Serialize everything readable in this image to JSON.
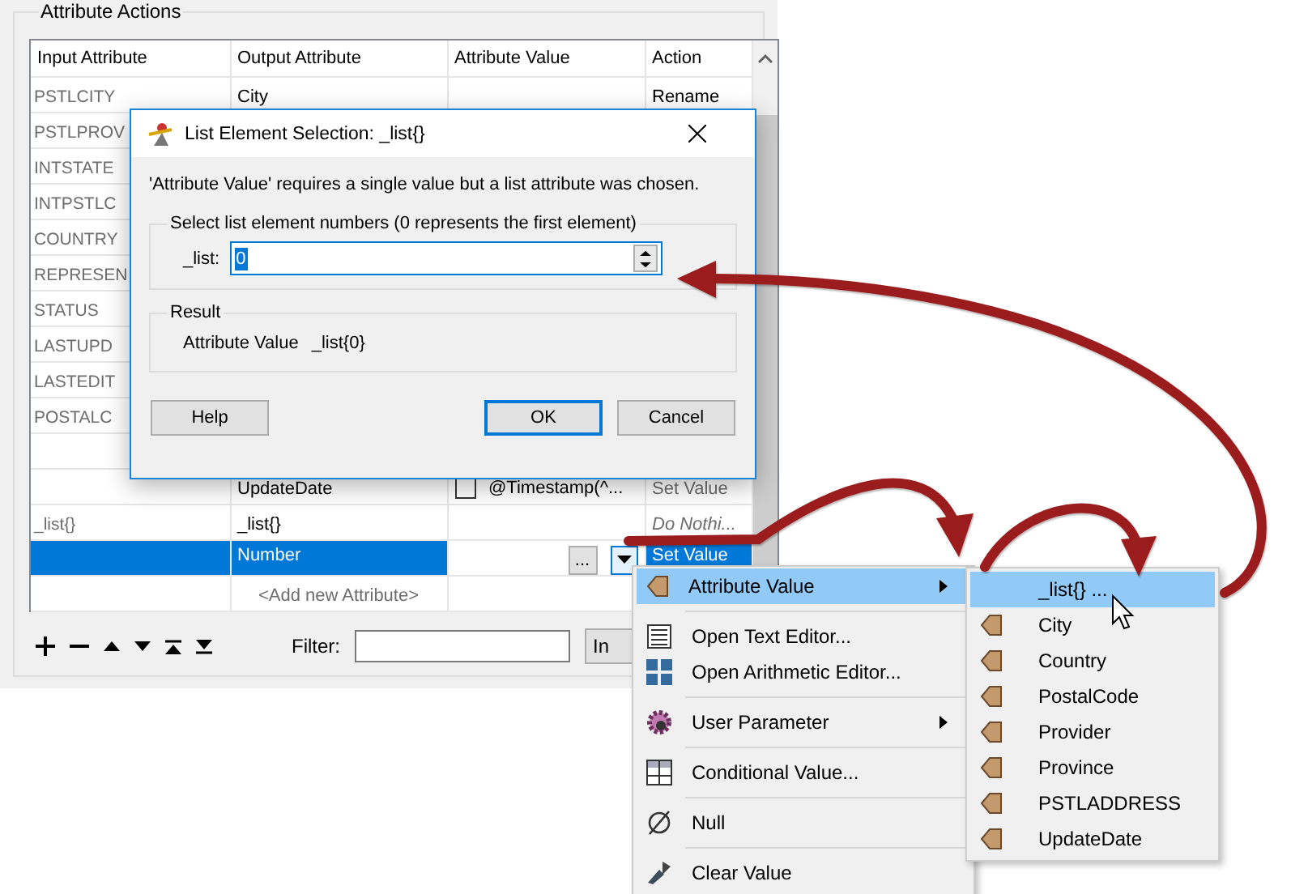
{
  "group_title": "Attribute Actions",
  "table": {
    "columns": [
      "Input Attribute",
      "Output Attribute",
      "Attribute Value",
      "Action"
    ],
    "rows": [
      {
        "kind": "plain",
        "input": "PSTLCITY",
        "output": "City",
        "value": "",
        "action": "Rename",
        "action_default": false,
        "selected": false
      },
      {
        "kind": "plain",
        "input": "PSTLPROV",
        "output": "",
        "value": "",
        "action": "",
        "selected": false
      },
      {
        "kind": "plain",
        "input": "INTSTATE",
        "output": "",
        "value": "",
        "action": "",
        "selected": false
      },
      {
        "kind": "plain",
        "input": "INTPSTLC",
        "output": "",
        "value": "",
        "action": "",
        "selected": false
      },
      {
        "kind": "plain",
        "input": "COUNTRY",
        "output": "",
        "value": "",
        "action": "",
        "selected": false
      },
      {
        "kind": "plain",
        "input": "REPRESEN",
        "output": "",
        "value": "",
        "action": "",
        "selected": false
      },
      {
        "kind": "plain",
        "input": "STATUS",
        "output": "",
        "value": "",
        "action": "",
        "selected": false
      },
      {
        "kind": "plain",
        "input": "LASTUPD",
        "output": "",
        "value": "",
        "action": "",
        "selected": false
      },
      {
        "kind": "plain",
        "input": "LASTEDIT",
        "output": "",
        "value": "",
        "action": "",
        "selected": false
      },
      {
        "kind": "plain",
        "input": "POSTALC",
        "output": "",
        "value": "",
        "action": "",
        "selected": false
      },
      {
        "kind": "plain",
        "input": "",
        "output": "",
        "value": "",
        "action": "",
        "selected": false
      },
      {
        "kind": "checkbox",
        "input": "",
        "output": "UpdateDate",
        "value": "@Timestamp(^...",
        "checked": false,
        "action": "Set Value",
        "action_default": false,
        "selected": false
      },
      {
        "kind": "plain",
        "input": "_list{}",
        "output": "_list{}",
        "value": "",
        "action": "Do Nothi...",
        "action_default": true,
        "selected": false
      },
      {
        "kind": "editing",
        "input": "",
        "output": "Number",
        "value": "...",
        "action": "Set Value",
        "action_default": false,
        "selected": true
      },
      {
        "kind": "add",
        "input": "",
        "output": "<Add new Attribute>",
        "value": "",
        "action": "",
        "selected": false
      }
    ]
  },
  "filter": {
    "label": "Filter:"
  },
  "import_button": "In",
  "dialog": {
    "title": "List Element Selection: _list{}",
    "message": "'Attribute Value' requires a single value but a list attribute was chosen.",
    "group_title": "Select list element numbers (0 represents the first element)",
    "field_label": "_list:",
    "field_value": "0",
    "result_title": "Result",
    "result_label": "Attribute Value",
    "result_value": "_list{0}",
    "buttons": [
      {
        "label": "Help",
        "default": false
      },
      {
        "label": "OK",
        "default": true
      },
      {
        "label": "Cancel",
        "default": false
      }
    ]
  },
  "menu": {
    "sections": [
      [
        {
          "kind": "attribute",
          "label": "Attribute Value",
          "submenu": true,
          "selected": true
        }
      ],
      [
        {
          "kind": "texteditor",
          "label": "Open Text Editor...",
          "submenu": false,
          "selected": false
        },
        {
          "kind": "arithmetic",
          "label": "Open Arithmetic Editor...",
          "submenu": false,
          "selected": false
        }
      ],
      [
        {
          "kind": "parameter",
          "label": "User Parameter",
          "submenu": true,
          "selected": false
        }
      ],
      [
        {
          "kind": "conditional",
          "label": "Conditional Value...",
          "submenu": false,
          "selected": false
        }
      ],
      [
        {
          "kind": "null",
          "label": "Null",
          "submenu": false,
          "selected": false
        }
      ],
      [
        {
          "kind": "clear",
          "label": "Clear Value",
          "submenu": false,
          "selected": false
        }
      ]
    ]
  },
  "submenu": {
    "items": [
      {
        "kind": "list",
        "label": "_list{} ...",
        "selected": true
      },
      {
        "kind": "attribute",
        "label": "City",
        "selected": false
      },
      {
        "kind": "attribute",
        "label": "Country",
        "selected": false
      },
      {
        "kind": "attribute",
        "label": "PostalCode",
        "selected": false
      },
      {
        "kind": "attribute",
        "label": "Provider",
        "selected": false
      },
      {
        "kind": "attribute",
        "label": "Province",
        "selected": false
      },
      {
        "kind": "attribute",
        "label": "PSTLADDRESS",
        "selected": false
      },
      {
        "kind": "attribute",
        "label": "UpdateDate",
        "selected": false
      }
    ]
  }
}
